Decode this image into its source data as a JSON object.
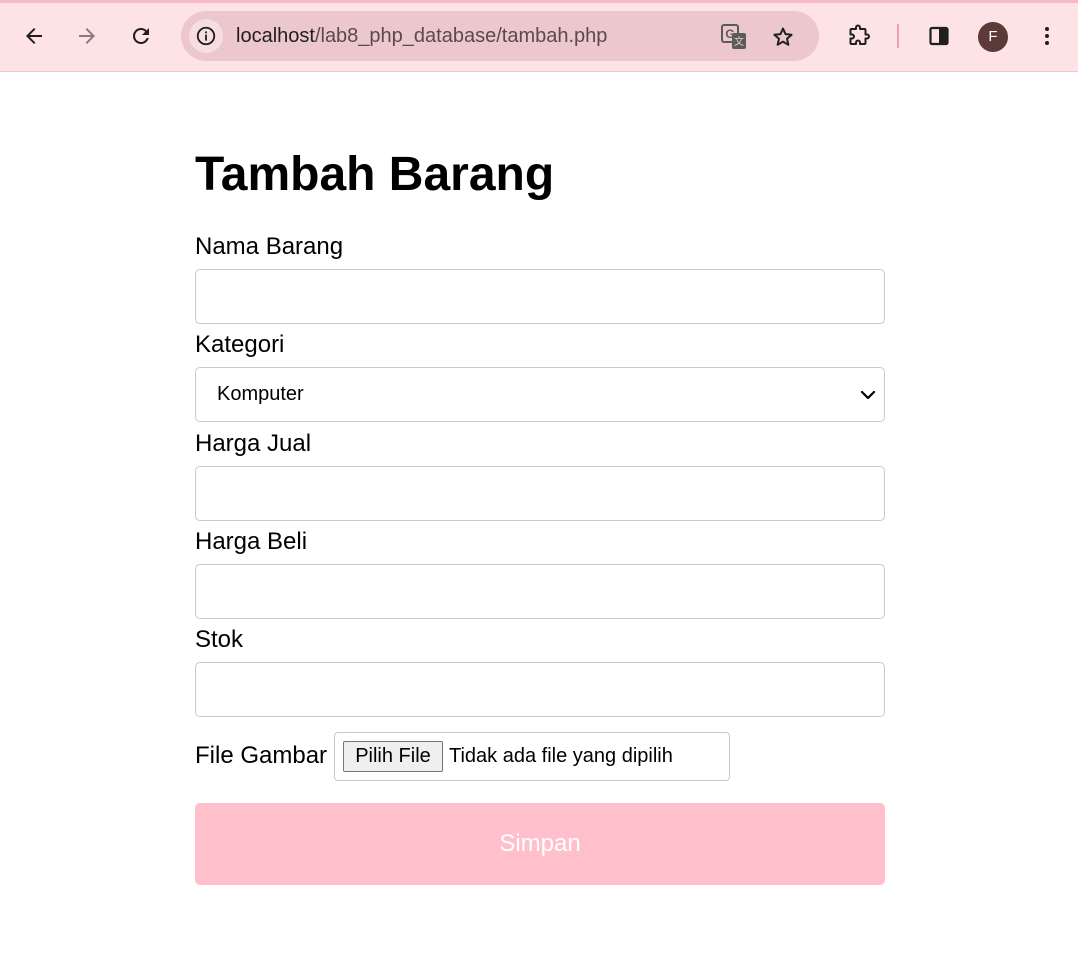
{
  "browser": {
    "url_host": "localhost",
    "url_path": "/lab8_php_database/tambah.php",
    "avatar_initial": "F",
    "icons": [
      "back-arrow-icon",
      "forward-arrow-icon",
      "reload-icon",
      "site-info-icon",
      "translate-icon",
      "bookmark-star-icon",
      "extensions-icon",
      "side-panel-icon",
      "more-menu-icon"
    ],
    "theme_color": "#fde2e6"
  },
  "form": {
    "title": "Tambah Barang",
    "fields": {
      "nama": {
        "label": "Nama Barang",
        "value": ""
      },
      "kategori": {
        "label": "Kategori",
        "selected": "Komputer"
      },
      "harga_jual": {
        "label": "Harga Jual",
        "value": ""
      },
      "harga_beli": {
        "label": "Harga Beli",
        "value": ""
      },
      "stok": {
        "label": "Stok",
        "value": ""
      }
    },
    "file": {
      "label": "File Gambar",
      "button": "Pilih File",
      "status": "Tidak ada file yang dipilih"
    },
    "submit_label": "Simpan",
    "submit_color": "#ffc0cb"
  }
}
